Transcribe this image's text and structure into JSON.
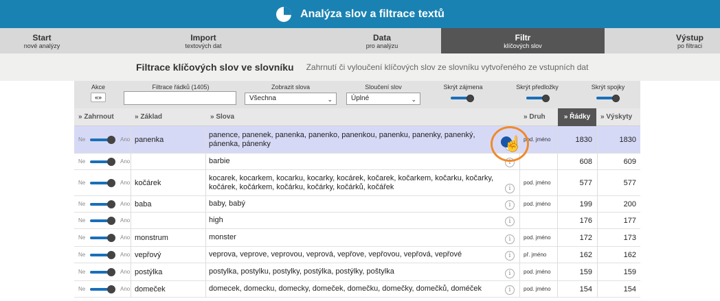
{
  "app": {
    "title": "Analýza slov a filtrace textů"
  },
  "nav": [
    {
      "label": "Start",
      "sub": "nové analýzy"
    },
    {
      "label": "Import",
      "sub": "textových dat"
    },
    {
      "label": "Data",
      "sub": "pro analýzu"
    },
    {
      "label": "Filtr",
      "sub": "klíčových slov"
    },
    {
      "label": "Výstup",
      "sub": "po filtraci"
    }
  ],
  "section": {
    "title": "Filtrace klíčových slov ve slovníku",
    "description": "Zahrnutí či vyloučení klíčových slov ze slovníku vytvořeného ze vstupních dat"
  },
  "filters": {
    "akce_label": "Akce",
    "akce_button": "«»",
    "filter_rows_label": "Filtrace řádků (1405)",
    "filter_rows_value": "",
    "show_words_label": "Zobrazit slova",
    "show_words_value": "Všechna",
    "merge_label": "Sloučení slov",
    "merge_value": "Úplné",
    "hide_pronouns": "Skrýt zájmena",
    "hide_prepositions": "Skrýt předložky",
    "hide_conjunctions": "Skrýt spojky"
  },
  "columns": {
    "include": "» Zahrnout",
    "base": "» Základ",
    "words": "» Slova",
    "kind": "» Druh",
    "rows": "» Řádky",
    "occurrences": "» Výskyty"
  },
  "toggle": {
    "off": "Ne",
    "on": "Ano"
  },
  "info_glyph": "i",
  "rows": [
    {
      "base": "panenka",
      "words": "panence, panenek, panenka, panenko, panenkou, panenku, panenky, panenký, pánenka, pánenky",
      "kind": "pod. jméno",
      "rows": "1830",
      "occurrences": "1830"
    },
    {
      "base": "",
      "words": "barbie",
      "kind": "",
      "rows": "608",
      "occurrences": "609"
    },
    {
      "base": "kočárek",
      "words": "kocarek, kocarkem, kocarku, kocarky, kocárek, kočarek, kočarkem, kočarku, kočarky, kočárek, kočárkem, kočárku, kočárky, kočárků, kočářek",
      "kind": "pod. jméno",
      "rows": "577",
      "occurrences": "577"
    },
    {
      "base": "baba",
      "words": "baby, babý",
      "kind": "pod. jméno",
      "rows": "199",
      "occurrences": "200"
    },
    {
      "base": "",
      "words": "high",
      "kind": "",
      "rows": "176",
      "occurrences": "177"
    },
    {
      "base": "monstrum",
      "words": "monster",
      "kind": "pod. jméno",
      "rows": "172",
      "occurrences": "173"
    },
    {
      "base": "vepřový",
      "words": "veprova, veprove, veprovou, veprová, vepřove, vepřovou, vepřová, vepřové",
      "kind": "př. jméno",
      "rows": "162",
      "occurrences": "162"
    },
    {
      "base": "postýlka",
      "words": "postylka, postylku, postylky, postýlka, postýlky, poštylka",
      "kind": "pod. jméno",
      "rows": "159",
      "occurrences": "159"
    },
    {
      "base": "domeček",
      "words": "domecek, domecku, domecky, domeček, domečku, domečky, domečků, doméček",
      "kind": "pod. jméno",
      "rows": "154",
      "occurrences": "154"
    }
  ]
}
